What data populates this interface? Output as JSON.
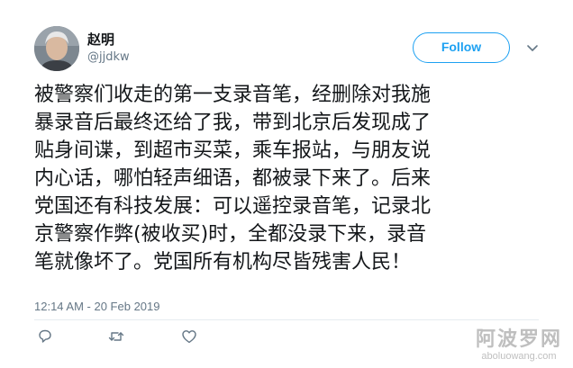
{
  "tweet": {
    "author": {
      "name": "赵明",
      "handle": "@jjdkw"
    },
    "follow_label": "Follow",
    "text_lines": [
      "被警察们收走的第一支录音笔，经删除对我施",
      "暴录音后最终还给了我，带到北京后发现成了",
      "贴身间谍，到超市买菜，乘车报站，与朋友说",
      "内心话，哪怕轻声细语，都被录下来了。后来",
      "党国还有科技发展：可以遥控录音笔，记录北",
      "京警察作弊(被收买)时，全都没录下来，录音",
      "笔就像坏了。党国所有机构尽皆残害人民！"
    ],
    "timestamp": "12:14 AM - 20 Feb 2019",
    "actions": [
      "reply-icon",
      "retweet-icon",
      "like-icon"
    ]
  },
  "watermark": {
    "text": "阿波罗网",
    "url": "aboluowang.com"
  },
  "colors": {
    "accent": "#1da1f2",
    "text": "#14171a",
    "muted": "#657786"
  }
}
